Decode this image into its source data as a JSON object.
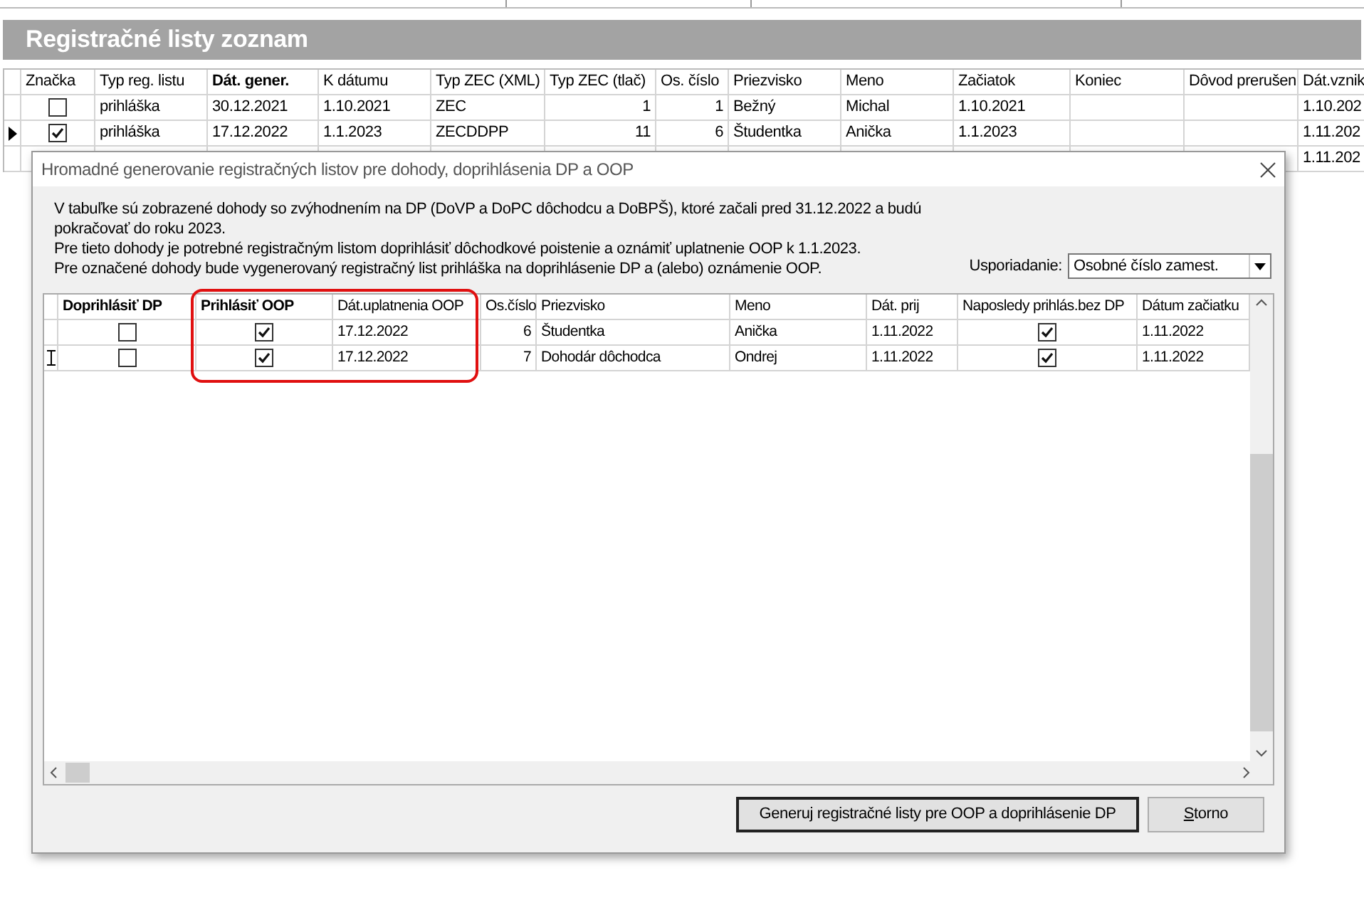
{
  "main_window": {
    "title": "Registračné listy zoznam",
    "table": {
      "columns": [
        {
          "label": "Značka",
          "kind": "check",
          "bold": false
        },
        {
          "label": "Typ reg. listu",
          "kind": "text",
          "bold": false
        },
        {
          "label": "Dát. gener.",
          "kind": "text",
          "bold": true
        },
        {
          "label": "K dátumu",
          "kind": "text",
          "bold": false
        },
        {
          "label": "Typ ZEC (XML)",
          "kind": "text",
          "bold": false
        },
        {
          "label": "Typ ZEC (tlač)",
          "kind": "number",
          "bold": false
        },
        {
          "label": "Os. číslo",
          "kind": "number",
          "bold": false
        },
        {
          "label": "Priezvisko",
          "kind": "text",
          "bold": false
        },
        {
          "label": "Meno",
          "kind": "text",
          "bold": false
        },
        {
          "label": "Začiatok",
          "kind": "text",
          "bold": false
        },
        {
          "label": "Koniec",
          "kind": "text",
          "bold": false
        },
        {
          "label": "Dôvod prerušen",
          "kind": "text",
          "bold": false
        },
        {
          "label": "Dát.vznik",
          "kind": "text",
          "bold": false
        }
      ],
      "rows": [
        {
          "current": false,
          "cells": [
            {
              "checked": false
            },
            "prihláška",
            "30.12.2021",
            "1.10.2021",
            "ZEC",
            "1",
            "1",
            "Bežný",
            "Michal",
            "1.10.2021",
            null,
            null,
            "1.10.202"
          ]
        },
        {
          "current": true,
          "cells": [
            {
              "checked": true
            },
            "prihláška",
            "17.12.2022",
            "1.1.2023",
            "ZECDDPP",
            "11",
            "6",
            "Študentka",
            "Anička",
            "1.1.2023",
            null,
            null,
            "1.11.202"
          ]
        },
        {
          "current": false,
          "cells": [
            null,
            null,
            null,
            null,
            null,
            null,
            null,
            null,
            null,
            null,
            null,
            null,
            "1.11.202"
          ]
        }
      ]
    }
  },
  "dialog": {
    "title": "Hromadné generovanie registračných listov pre dohody, doprihlásenia DP a OOP",
    "description": [
      "V tabuľke sú zobrazené dohody so zvýhodnením na DP (DoVP a DoPC dôchodcu a DoBPŠ), ktoré začali pred 31.12.2022 a budú pokračovať do roku 2023.",
      "Pre tieto dohody je potrebné registračným listom doprihlásiť dôchodkové poistenie a oznámiť uplatnenie OOP k 1.1.2023.",
      "Pre označené dohody bude vygenerovaný registračný list prihláška na doprihlásenie DP a (alebo) oznámenie OOP."
    ],
    "sort": {
      "label": "Usporiadanie:",
      "value": "Osobné číslo zamest."
    },
    "table": {
      "columns": [
        {
          "label": "Doprihlásiť DP",
          "kind": "check",
          "bold": true
        },
        {
          "label": "Prihlásiť OOP",
          "kind": "check",
          "bold": true
        },
        {
          "label": "Dát.uplatnenia OOP",
          "kind": "text",
          "bold": false
        },
        {
          "label": "Os.číslo",
          "kind": "number",
          "bold": false
        },
        {
          "label": "Priezvisko",
          "kind": "text",
          "bold": false
        },
        {
          "label": "Meno",
          "kind": "text",
          "bold": false
        },
        {
          "label": "Dát. prij",
          "kind": "text",
          "bold": false
        },
        {
          "label": "Naposledy prihlás.bez DP",
          "kind": "check",
          "bold": false
        },
        {
          "label": "Dátum začiatku",
          "kind": "text",
          "bold": false
        }
      ],
      "rows": [
        {
          "current": false,
          "cells": [
            {
              "checked": false
            },
            {
              "checked": true
            },
            "17.12.2022",
            "6",
            "Študentka",
            "Anička",
            "1.11.2022",
            {
              "checked": true
            },
            "1.11.2022"
          ]
        },
        {
          "current": true,
          "cells": [
            {
              "checked": false
            },
            {
              "checked": true
            },
            "17.12.2022",
            "7",
            "Dohodár dôchodca",
            "Ondrej",
            "1.11.2022",
            {
              "checked": true
            },
            "1.11.2022"
          ]
        }
      ]
    },
    "buttons": [
      {
        "label": "Generuj registračné listy pre OOP a doprihlásenie DP",
        "default": true,
        "accelerator": false
      },
      {
        "label": "Storno",
        "default": false,
        "accelerator": true
      }
    ]
  }
}
